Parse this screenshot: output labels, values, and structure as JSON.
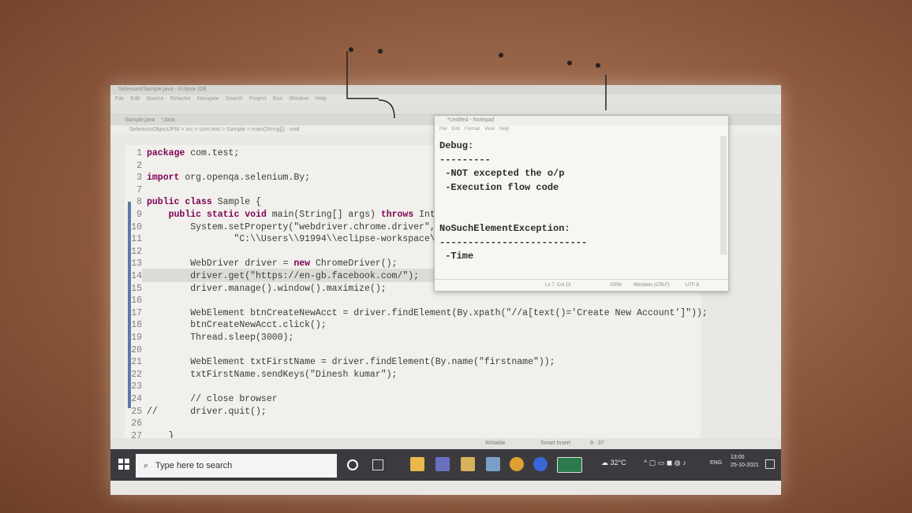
{
  "window": {
    "title": "Selenium/Sample.java - Eclipse IDE"
  },
  "menu": [
    "File",
    "Edit",
    "Source",
    "Refactor",
    "Navigate",
    "Search",
    "Project",
    "Run",
    "Window",
    "Help"
  ],
  "tabs": {
    "editor_tab": "Sample.java",
    "other_tab": "*Java"
  },
  "breadcrumb": "SeleniumObjectJPM > src > com.test > Sample > main(String[]) : void",
  "code": [
    {
      "n": "1",
      "t": "package com.test;"
    },
    {
      "n": "2",
      "t": ""
    },
    {
      "n": "3",
      "t": "import org.openqa.selenium.By;"
    },
    {
      "n": "7",
      "t": ""
    },
    {
      "n": "8",
      "t": "public class Sample {"
    },
    {
      "n": "9",
      "t": "    public static void main(String[] args) throws Inter"
    },
    {
      "n": "10",
      "t": "        System.setProperty(\"webdriver.chrome.driver\","
    },
    {
      "n": "11",
      "t": "                \"C:\\\\Users\\\\91994\\\\eclipse-workspace\\\\C"
    },
    {
      "n": "12",
      "t": ""
    },
    {
      "n": "13",
      "t": "        WebDriver driver = new ChromeDriver();"
    },
    {
      "n": "14",
      "t": "        driver.get(\"https://en-gb.facebook.com/\");"
    },
    {
      "n": "15",
      "t": "        driver.manage().window().maximize();"
    },
    {
      "n": "16",
      "t": ""
    },
    {
      "n": "17",
      "t": "        WebElement btnCreateNewAcct = driver.findElement(By.xpath(\"//a[text()='Create New Account']\"));"
    },
    {
      "n": "18",
      "t": "        btnCreateNewAcct.click();"
    },
    {
      "n": "19",
      "t": "        Thread.sleep(3000);"
    },
    {
      "n": "20",
      "t": ""
    },
    {
      "n": "21",
      "t": "        WebElement txtFirstName = driver.findElement(By.name(\"firstname\"));"
    },
    {
      "n": "22",
      "t": "        txtFirstName.sendKeys(\"Dinesh kumar\");"
    },
    {
      "n": "23",
      "t": ""
    },
    {
      "n": "24",
      "t": "        // close browser"
    },
    {
      "n": "25",
      "t": "//      driver.quit();"
    },
    {
      "n": "26",
      "t": ""
    },
    {
      "n": "27",
      "t": "    }"
    }
  ],
  "notepad": {
    "title": "*Untitled - Notepad",
    "menu": [
      "File",
      "Edit",
      "Format",
      "View",
      "Help"
    ],
    "text": "Debug:\n---------\n -NOT excepted the o/p\n -Execution flow code\n\n\nNoSuchElementException:\n--------------------------\n -Time",
    "status": {
      "pos": "Ln 7, Col 13",
      "zoom": "100%",
      "eol": "Windows (CRLF)",
      "enc": "UTF-8"
    }
  },
  "statusbar": {
    "mode": "Writable",
    "insert": "Smart Insert",
    "position": "9 : 37"
  },
  "taskbar": {
    "search_placeholder": "Type here to search",
    "weather": "32°C",
    "lang": "ENG",
    "time": "13:00",
    "date": "25-10-2021"
  }
}
